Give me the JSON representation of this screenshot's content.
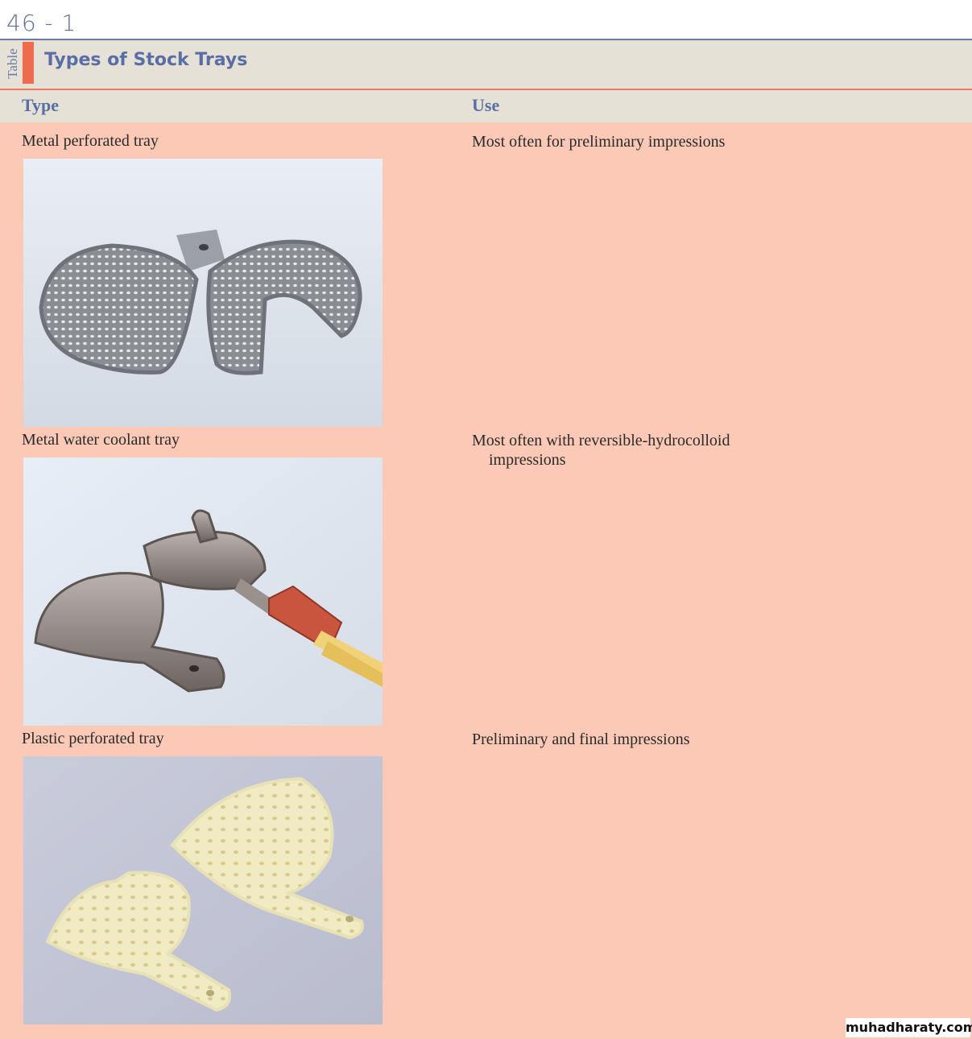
{
  "page": {
    "handwritten_label": "46 - 1",
    "table_word": "Table",
    "title": "Types of Stock Trays",
    "watermark": "muhadharaty.com"
  },
  "columns": {
    "type": "Type",
    "use": "Use"
  },
  "rows": [
    {
      "type": "Metal perforated tray",
      "use": "Most often for preliminary impressions",
      "photo": "metal-perforated-trays"
    },
    {
      "type": "Metal water coolant tray",
      "use": "Most often with reversible-hydrocolloid impressions",
      "photo": "metal-water-coolant-tray"
    },
    {
      "type": "Plastic perforated tray",
      "use": "Preliminary and final impressions",
      "photo": "plastic-perforated-trays"
    }
  ],
  "colors": {
    "accent_blue": "#5a6ea6",
    "accent_orange": "#ef6b4d",
    "band_beige": "#e6e1d6",
    "body_salmon": "#fbc9b6"
  }
}
